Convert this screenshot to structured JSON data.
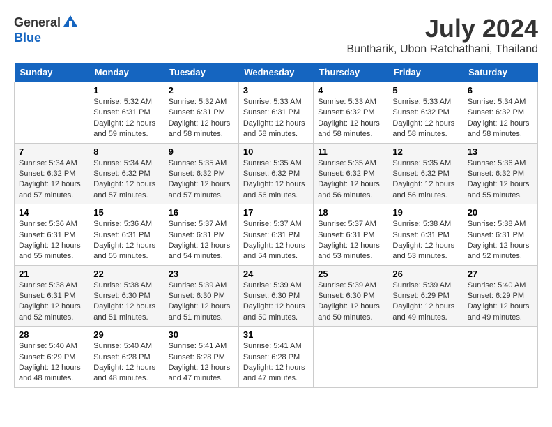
{
  "header": {
    "logo_general": "General",
    "logo_blue": "Blue",
    "month_year": "July 2024",
    "location": "Buntharik, Ubon Ratchathani, Thailand"
  },
  "days_of_week": [
    "Sunday",
    "Monday",
    "Tuesday",
    "Wednesday",
    "Thursday",
    "Friday",
    "Saturday"
  ],
  "weeks": [
    [
      {
        "day": "",
        "sunrise": "",
        "sunset": "",
        "daylight": "",
        "empty": true
      },
      {
        "day": "1",
        "sunrise": "Sunrise: 5:32 AM",
        "sunset": "Sunset: 6:31 PM",
        "daylight": "Daylight: 12 hours and 59 minutes."
      },
      {
        "day": "2",
        "sunrise": "Sunrise: 5:32 AM",
        "sunset": "Sunset: 6:31 PM",
        "daylight": "Daylight: 12 hours and 58 minutes."
      },
      {
        "day": "3",
        "sunrise": "Sunrise: 5:33 AM",
        "sunset": "Sunset: 6:31 PM",
        "daylight": "Daylight: 12 hours and 58 minutes."
      },
      {
        "day": "4",
        "sunrise": "Sunrise: 5:33 AM",
        "sunset": "Sunset: 6:32 PM",
        "daylight": "Daylight: 12 hours and 58 minutes."
      },
      {
        "day": "5",
        "sunrise": "Sunrise: 5:33 AM",
        "sunset": "Sunset: 6:32 PM",
        "daylight": "Daylight: 12 hours and 58 minutes."
      },
      {
        "day": "6",
        "sunrise": "Sunrise: 5:34 AM",
        "sunset": "Sunset: 6:32 PM",
        "daylight": "Daylight: 12 hours and 58 minutes."
      }
    ],
    [
      {
        "day": "7",
        "sunrise": "Sunrise: 5:34 AM",
        "sunset": "Sunset: 6:32 PM",
        "daylight": "Daylight: 12 hours and 57 minutes."
      },
      {
        "day": "8",
        "sunrise": "Sunrise: 5:34 AM",
        "sunset": "Sunset: 6:32 PM",
        "daylight": "Daylight: 12 hours and 57 minutes."
      },
      {
        "day": "9",
        "sunrise": "Sunrise: 5:35 AM",
        "sunset": "Sunset: 6:32 PM",
        "daylight": "Daylight: 12 hours and 57 minutes."
      },
      {
        "day": "10",
        "sunrise": "Sunrise: 5:35 AM",
        "sunset": "Sunset: 6:32 PM",
        "daylight": "Daylight: 12 hours and 56 minutes."
      },
      {
        "day": "11",
        "sunrise": "Sunrise: 5:35 AM",
        "sunset": "Sunset: 6:32 PM",
        "daylight": "Daylight: 12 hours and 56 minutes."
      },
      {
        "day": "12",
        "sunrise": "Sunrise: 5:35 AM",
        "sunset": "Sunset: 6:32 PM",
        "daylight": "Daylight: 12 hours and 56 minutes."
      },
      {
        "day": "13",
        "sunrise": "Sunrise: 5:36 AM",
        "sunset": "Sunset: 6:32 PM",
        "daylight": "Daylight: 12 hours and 55 minutes."
      }
    ],
    [
      {
        "day": "14",
        "sunrise": "Sunrise: 5:36 AM",
        "sunset": "Sunset: 6:31 PM",
        "daylight": "Daylight: 12 hours and 55 minutes."
      },
      {
        "day": "15",
        "sunrise": "Sunrise: 5:36 AM",
        "sunset": "Sunset: 6:31 PM",
        "daylight": "Daylight: 12 hours and 55 minutes."
      },
      {
        "day": "16",
        "sunrise": "Sunrise: 5:37 AM",
        "sunset": "Sunset: 6:31 PM",
        "daylight": "Daylight: 12 hours and 54 minutes."
      },
      {
        "day": "17",
        "sunrise": "Sunrise: 5:37 AM",
        "sunset": "Sunset: 6:31 PM",
        "daylight": "Daylight: 12 hours and 54 minutes."
      },
      {
        "day": "18",
        "sunrise": "Sunrise: 5:37 AM",
        "sunset": "Sunset: 6:31 PM",
        "daylight": "Daylight: 12 hours and 53 minutes."
      },
      {
        "day": "19",
        "sunrise": "Sunrise: 5:38 AM",
        "sunset": "Sunset: 6:31 PM",
        "daylight": "Daylight: 12 hours and 53 minutes."
      },
      {
        "day": "20",
        "sunrise": "Sunrise: 5:38 AM",
        "sunset": "Sunset: 6:31 PM",
        "daylight": "Daylight: 12 hours and 52 minutes."
      }
    ],
    [
      {
        "day": "21",
        "sunrise": "Sunrise: 5:38 AM",
        "sunset": "Sunset: 6:31 PM",
        "daylight": "Daylight: 12 hours and 52 minutes."
      },
      {
        "day": "22",
        "sunrise": "Sunrise: 5:38 AM",
        "sunset": "Sunset: 6:30 PM",
        "daylight": "Daylight: 12 hours and 51 minutes."
      },
      {
        "day": "23",
        "sunrise": "Sunrise: 5:39 AM",
        "sunset": "Sunset: 6:30 PM",
        "daylight": "Daylight: 12 hours and 51 minutes."
      },
      {
        "day": "24",
        "sunrise": "Sunrise: 5:39 AM",
        "sunset": "Sunset: 6:30 PM",
        "daylight": "Daylight: 12 hours and 50 minutes."
      },
      {
        "day": "25",
        "sunrise": "Sunrise: 5:39 AM",
        "sunset": "Sunset: 6:30 PM",
        "daylight": "Daylight: 12 hours and 50 minutes."
      },
      {
        "day": "26",
        "sunrise": "Sunrise: 5:39 AM",
        "sunset": "Sunset: 6:29 PM",
        "daylight": "Daylight: 12 hours and 49 minutes."
      },
      {
        "day": "27",
        "sunrise": "Sunrise: 5:40 AM",
        "sunset": "Sunset: 6:29 PM",
        "daylight": "Daylight: 12 hours and 49 minutes."
      }
    ],
    [
      {
        "day": "28",
        "sunrise": "Sunrise: 5:40 AM",
        "sunset": "Sunset: 6:29 PM",
        "daylight": "Daylight: 12 hours and 48 minutes."
      },
      {
        "day": "29",
        "sunrise": "Sunrise: 5:40 AM",
        "sunset": "Sunset: 6:28 PM",
        "daylight": "Daylight: 12 hours and 48 minutes."
      },
      {
        "day": "30",
        "sunrise": "Sunrise: 5:41 AM",
        "sunset": "Sunset: 6:28 PM",
        "daylight": "Daylight: 12 hours and 47 minutes."
      },
      {
        "day": "31",
        "sunrise": "Sunrise: 5:41 AM",
        "sunset": "Sunset: 6:28 PM",
        "daylight": "Daylight: 12 hours and 47 minutes."
      },
      {
        "day": "",
        "sunrise": "",
        "sunset": "",
        "daylight": "",
        "empty": true
      },
      {
        "day": "",
        "sunrise": "",
        "sunset": "",
        "daylight": "",
        "empty": true
      },
      {
        "day": "",
        "sunrise": "",
        "sunset": "",
        "daylight": "",
        "empty": true
      }
    ]
  ]
}
